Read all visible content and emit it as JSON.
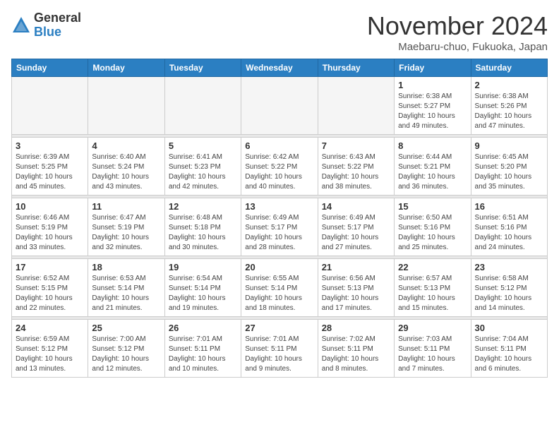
{
  "header": {
    "logo_general": "General",
    "logo_blue": "Blue",
    "month_title": "November 2024",
    "subtitle": "Maebaru-chuo, Fukuoka, Japan"
  },
  "weekdays": [
    "Sunday",
    "Monday",
    "Tuesday",
    "Wednesday",
    "Thursday",
    "Friday",
    "Saturday"
  ],
  "weeks": [
    [
      {
        "day": "",
        "info": ""
      },
      {
        "day": "",
        "info": ""
      },
      {
        "day": "",
        "info": ""
      },
      {
        "day": "",
        "info": ""
      },
      {
        "day": "",
        "info": ""
      },
      {
        "day": "1",
        "info": "Sunrise: 6:38 AM\nSunset: 5:27 PM\nDaylight: 10 hours\nand 49 minutes."
      },
      {
        "day": "2",
        "info": "Sunrise: 6:38 AM\nSunset: 5:26 PM\nDaylight: 10 hours\nand 47 minutes."
      }
    ],
    [
      {
        "day": "3",
        "info": "Sunrise: 6:39 AM\nSunset: 5:25 PM\nDaylight: 10 hours\nand 45 minutes."
      },
      {
        "day": "4",
        "info": "Sunrise: 6:40 AM\nSunset: 5:24 PM\nDaylight: 10 hours\nand 43 minutes."
      },
      {
        "day": "5",
        "info": "Sunrise: 6:41 AM\nSunset: 5:23 PM\nDaylight: 10 hours\nand 42 minutes."
      },
      {
        "day": "6",
        "info": "Sunrise: 6:42 AM\nSunset: 5:22 PM\nDaylight: 10 hours\nand 40 minutes."
      },
      {
        "day": "7",
        "info": "Sunrise: 6:43 AM\nSunset: 5:22 PM\nDaylight: 10 hours\nand 38 minutes."
      },
      {
        "day": "8",
        "info": "Sunrise: 6:44 AM\nSunset: 5:21 PM\nDaylight: 10 hours\nand 36 minutes."
      },
      {
        "day": "9",
        "info": "Sunrise: 6:45 AM\nSunset: 5:20 PM\nDaylight: 10 hours\nand 35 minutes."
      }
    ],
    [
      {
        "day": "10",
        "info": "Sunrise: 6:46 AM\nSunset: 5:19 PM\nDaylight: 10 hours\nand 33 minutes."
      },
      {
        "day": "11",
        "info": "Sunrise: 6:47 AM\nSunset: 5:19 PM\nDaylight: 10 hours\nand 32 minutes."
      },
      {
        "day": "12",
        "info": "Sunrise: 6:48 AM\nSunset: 5:18 PM\nDaylight: 10 hours\nand 30 minutes."
      },
      {
        "day": "13",
        "info": "Sunrise: 6:49 AM\nSunset: 5:17 PM\nDaylight: 10 hours\nand 28 minutes."
      },
      {
        "day": "14",
        "info": "Sunrise: 6:49 AM\nSunset: 5:17 PM\nDaylight: 10 hours\nand 27 minutes."
      },
      {
        "day": "15",
        "info": "Sunrise: 6:50 AM\nSunset: 5:16 PM\nDaylight: 10 hours\nand 25 minutes."
      },
      {
        "day": "16",
        "info": "Sunrise: 6:51 AM\nSunset: 5:16 PM\nDaylight: 10 hours\nand 24 minutes."
      }
    ],
    [
      {
        "day": "17",
        "info": "Sunrise: 6:52 AM\nSunset: 5:15 PM\nDaylight: 10 hours\nand 22 minutes."
      },
      {
        "day": "18",
        "info": "Sunrise: 6:53 AM\nSunset: 5:14 PM\nDaylight: 10 hours\nand 21 minutes."
      },
      {
        "day": "19",
        "info": "Sunrise: 6:54 AM\nSunset: 5:14 PM\nDaylight: 10 hours\nand 19 minutes."
      },
      {
        "day": "20",
        "info": "Sunrise: 6:55 AM\nSunset: 5:14 PM\nDaylight: 10 hours\nand 18 minutes."
      },
      {
        "day": "21",
        "info": "Sunrise: 6:56 AM\nSunset: 5:13 PM\nDaylight: 10 hours\nand 17 minutes."
      },
      {
        "day": "22",
        "info": "Sunrise: 6:57 AM\nSunset: 5:13 PM\nDaylight: 10 hours\nand 15 minutes."
      },
      {
        "day": "23",
        "info": "Sunrise: 6:58 AM\nSunset: 5:12 PM\nDaylight: 10 hours\nand 14 minutes."
      }
    ],
    [
      {
        "day": "24",
        "info": "Sunrise: 6:59 AM\nSunset: 5:12 PM\nDaylight: 10 hours\nand 13 minutes."
      },
      {
        "day": "25",
        "info": "Sunrise: 7:00 AM\nSunset: 5:12 PM\nDaylight: 10 hours\nand 12 minutes."
      },
      {
        "day": "26",
        "info": "Sunrise: 7:01 AM\nSunset: 5:11 PM\nDaylight: 10 hours\nand 10 minutes."
      },
      {
        "day": "27",
        "info": "Sunrise: 7:01 AM\nSunset: 5:11 PM\nDaylight: 10 hours\nand 9 minutes."
      },
      {
        "day": "28",
        "info": "Sunrise: 7:02 AM\nSunset: 5:11 PM\nDaylight: 10 hours\nand 8 minutes."
      },
      {
        "day": "29",
        "info": "Sunrise: 7:03 AM\nSunset: 5:11 PM\nDaylight: 10 hours\nand 7 minutes."
      },
      {
        "day": "30",
        "info": "Sunrise: 7:04 AM\nSunset: 5:11 PM\nDaylight: 10 hours\nand 6 minutes."
      }
    ]
  ]
}
